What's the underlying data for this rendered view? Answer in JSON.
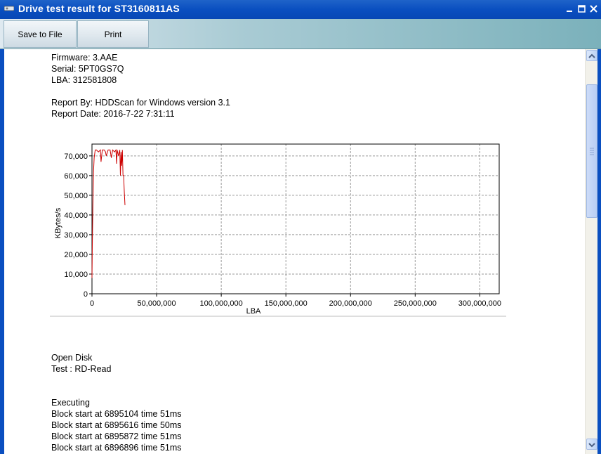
{
  "window": {
    "title": "Drive test result for ST3160811AS"
  },
  "toolbar": {
    "save_label": "Save to File",
    "print_label": "Print"
  },
  "report": {
    "firmware": "Firmware: 3.AAE",
    "serial": "Serial: 5PT0GS7Q",
    "lba": "LBA: 312581808",
    "report_by": "Report By: HDDScan for Windows version 3.1",
    "report_date": "Report Date: 2016-7-22 7:31:11",
    "open_disk": "Open Disk",
    "test": "Test : RD-Read",
    "executing": "Executing",
    "log": [
      "Block start at 6895104 time 51ms",
      "Block start at 6895616 time 50ms",
      "Block start at 6895872 time 51ms",
      "Block start at 6896896 time 51ms"
    ]
  },
  "chart_data": {
    "type": "line",
    "xlabel": "LBA",
    "ylabel": "KBytes/s",
    "xlim": [
      0,
      315000000
    ],
    "ylim": [
      0,
      76000
    ],
    "x_ticks": [
      "0",
      "50,000,000",
      "100,000,000",
      "150,000,000",
      "200,000,000",
      "250,000,000",
      "300,000,000"
    ],
    "y_ticks": [
      "0",
      "10,000",
      "20,000",
      "30,000",
      "40,000",
      "50,000",
      "60,000",
      "70,000"
    ],
    "grid": true,
    "series": [
      {
        "color": "#cc0000",
        "x": [
          0,
          300000,
          700000,
          1200000,
          1700000,
          2500000,
          3500000,
          5000000,
          6500000,
          7000000,
          8000000,
          9500000,
          10500000,
          11000000,
          12500000,
          14000000,
          15000000,
          16000000,
          17500000,
          18500000,
          19000000,
          19500000,
          20500000,
          21500000,
          22000000,
          22500000,
          23000000,
          23500000,
          24000000,
          24500000,
          25000000,
          25500000
        ],
        "y": [
          8000,
          28000,
          45000,
          62000,
          69000,
          73000,
          73000,
          72000,
          73000,
          67000,
          73000,
          73000,
          72000,
          70000,
          73000,
          73000,
          69000,
          73000,
          72000,
          73000,
          66000,
          73000,
          70000,
          73000,
          60000,
          72000,
          65000,
          73000,
          60000,
          60000,
          52000,
          45000
        ]
      }
    ]
  },
  "colors": {
    "titlebar": "#0a4fc0",
    "line": "#cc0000"
  },
  "icons": {
    "app": "hdd-icon",
    "minimize": "minimize-icon",
    "maximize": "maximize-icon",
    "close": "close-icon",
    "scroll_up": "arrow-up-icon",
    "scroll_down": "arrow-down-icon"
  }
}
